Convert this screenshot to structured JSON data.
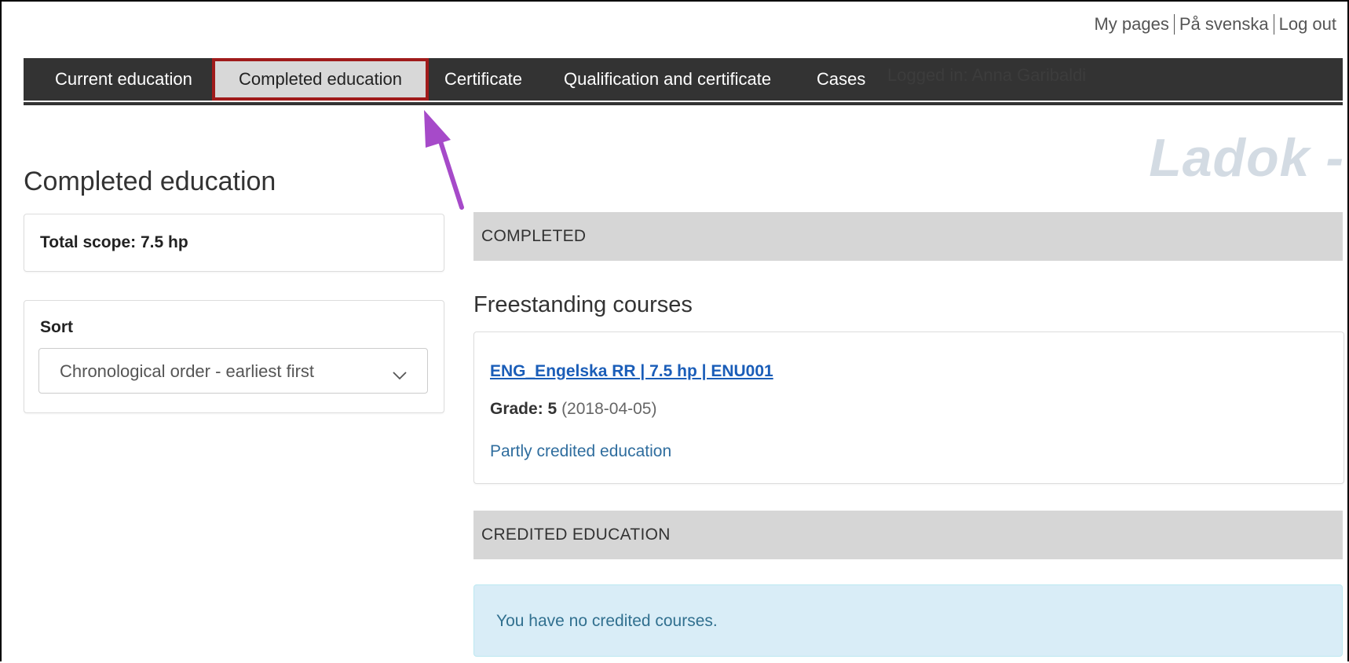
{
  "top_links": [
    "My pages",
    "På svenska",
    "Log out"
  ],
  "nav": {
    "tabs": [
      {
        "label": "Current education"
      },
      {
        "label": "Completed education",
        "active": true
      },
      {
        "label": "Certificate"
      },
      {
        "label": "Qualification and certificate"
      },
      {
        "label": "Cases"
      }
    ],
    "logged_in": "Logged in: Anna Garibaldi"
  },
  "brand_watermark": "Ladok -",
  "page_title": "Completed education",
  "scope": {
    "text": "Total scope: 7.5 hp"
  },
  "sort": {
    "label": "Sort",
    "selected": "Chronological order - earliest first"
  },
  "completed_section": {
    "header": "COMPLETED",
    "subheading": "Freestanding courses",
    "course": {
      "link": "ENG_Engelska RR | 7.5 hp | ENU001",
      "grade_label": "Grade:",
      "grade_value": "5",
      "grade_date": "(2018-04-05)",
      "credit_note": "Partly credited education"
    }
  },
  "credited_section": {
    "header": "CREDITED EDUCATION",
    "info": "You have no credited courses."
  },
  "colors": {
    "nav_bg": "#333333",
    "active_tab_bg": "#d8d8d8",
    "highlight_border": "#a01b1b",
    "annotation_arrow": "#a64ac9",
    "section_bg": "#d6d6d6",
    "info_bg": "#d9edf7",
    "link": "#1a5db8"
  },
  "icons": {
    "select_chevron": "chevron-down-icon",
    "annotation": "arrow-icon"
  }
}
